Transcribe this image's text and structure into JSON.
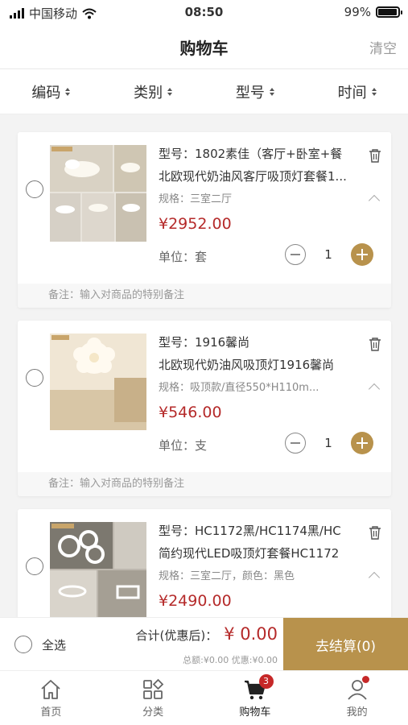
{
  "status_bar": {
    "carrier": "中国移动",
    "time": "08:50",
    "battery": "99%",
    "battery_level": 0.99
  },
  "nav": {
    "title": "购物车",
    "clear_label": "清空"
  },
  "sort": [
    "编码",
    "类别",
    "型号",
    "时间"
  ],
  "items": [
    {
      "model": "型号：1802素佳（客厅+卧室+餐",
      "name": "北欧现代奶油风客厅吸顶灯套餐1...",
      "spec": "规格：三室二厅",
      "price": "¥2952.00",
      "unit": "单位：套",
      "quantity": "1",
      "remark_placeholder": "备注：输入对商品的特别备注"
    },
    {
      "model": "型号：1916馨尚",
      "name": "北欧现代奶油风吸顶灯1916馨尚",
      "spec": "规格：吸顶款/直径550*H110m...",
      "price": "¥546.00",
      "unit": "单位：支",
      "quantity": "1",
      "remark_placeholder": "备注：输入对商品的特别备注"
    },
    {
      "model": "型号：HC1172黑/HC1174黑/HC",
      "name": "简约现代LED吸顶灯套餐HC1172",
      "spec": "规格：三室二厅，颜色：黑色",
      "price": "¥2490.00"
    }
  ],
  "checkout": {
    "select_all": "全选",
    "total_label": "合计(优惠后)：",
    "total_amount": "¥ 0.00",
    "sub_total": "总额:¥0.00 优惠:¥0.00",
    "button": "去结算(0)"
  },
  "tabbar": [
    {
      "label": "首页",
      "icon": "home-icon"
    },
    {
      "label": "分类",
      "icon": "category-icon"
    },
    {
      "label": "购物车",
      "icon": "cart-icon",
      "badge": "3"
    },
    {
      "label": "我的",
      "icon": "user-icon"
    }
  ],
  "colors": {
    "accent": "#b8924c",
    "price": "#b52a2a"
  }
}
